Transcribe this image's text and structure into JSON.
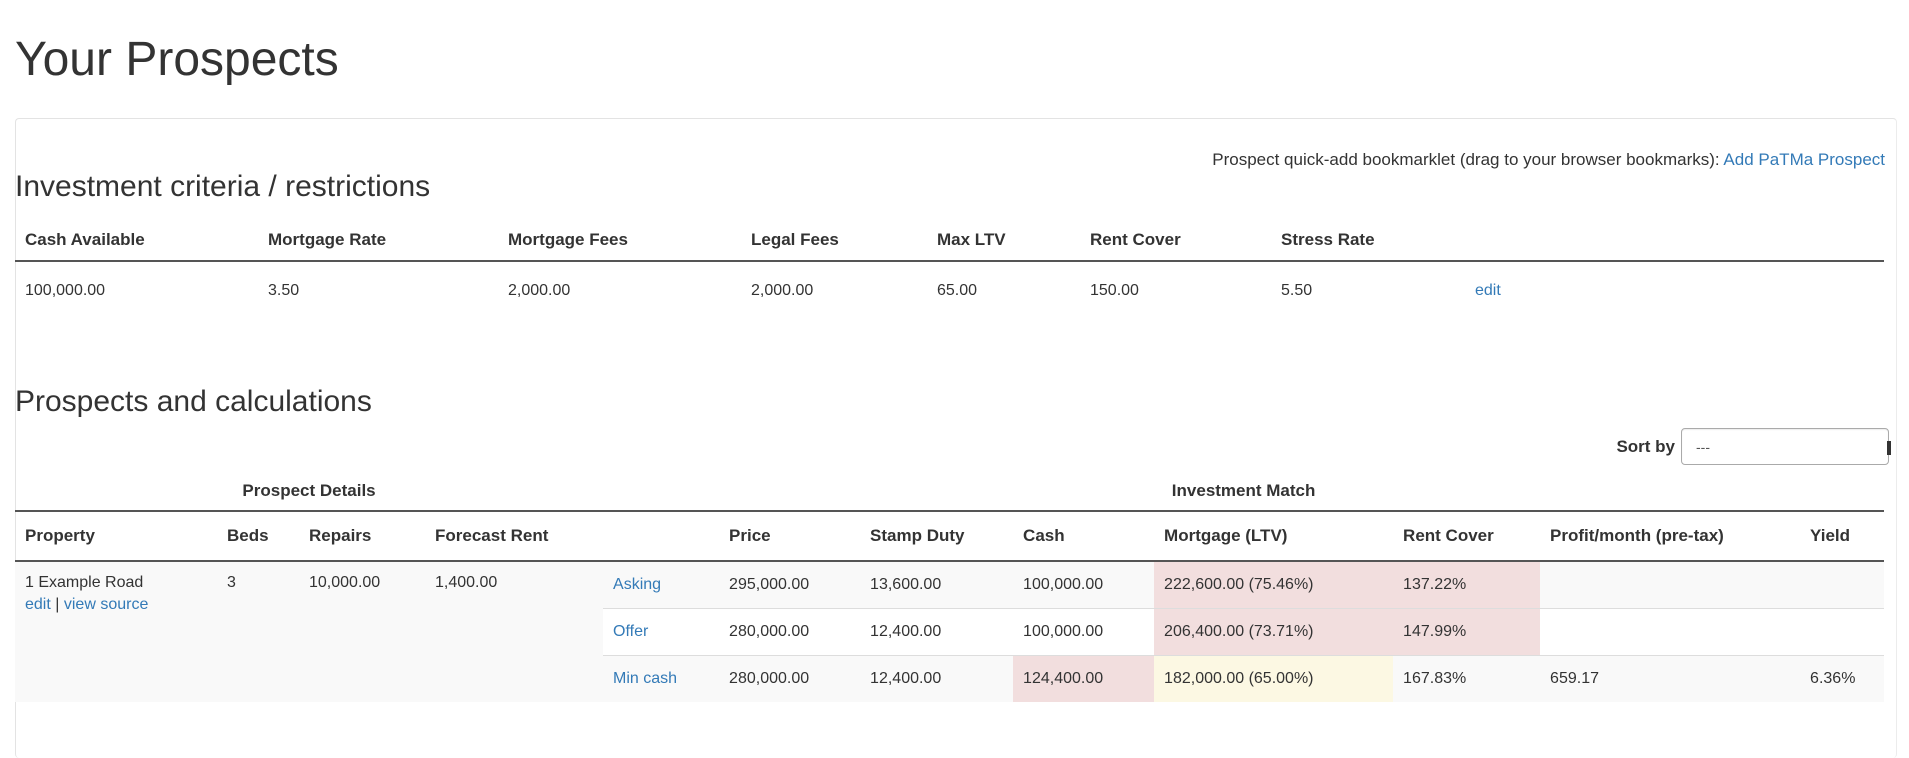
{
  "page_title": "Your Prospects",
  "bookmarklet": {
    "text": "Prospect quick-add bookmarklet (drag to your browser bookmarks): ",
    "link": "Add PaTMa Prospect"
  },
  "criteria": {
    "title": "Investment criteria / restrictions",
    "headers": [
      "Cash Available",
      "Mortgage Rate",
      "Mortgage Fees",
      "Legal Fees",
      "Max LTV",
      "Rent Cover",
      "Stress Rate"
    ],
    "values": [
      "100,000.00",
      "3.50",
      "2,000.00",
      "2,000.00",
      "65.00",
      "150.00",
      "5.50"
    ],
    "edit_label": "edit"
  },
  "prospects": {
    "title": "Prospects and calculations",
    "sort_label": "Sort by",
    "sort_value": "---",
    "group_headers": {
      "details": "Prospect Details",
      "match": "Investment Match"
    },
    "headers": [
      "Property",
      "Beds",
      "Repairs",
      "Forecast Rent",
      "",
      "Price",
      "Stamp Duty",
      "Cash",
      "Mortgage (LTV)",
      "Rent Cover",
      "Profit/month (pre-tax)",
      "Yield"
    ],
    "property": {
      "name": "1 Example Road",
      "edit_label": "edit",
      "separator": "|",
      "view_source_label": "view source",
      "beds": "3",
      "repairs": "10,000.00",
      "forecast_rent": "1,400.00"
    },
    "scenarios": [
      {
        "label": "Asking",
        "price": "295,000.00",
        "stamp_duty": "13,600.00",
        "cash": "100,000.00",
        "mortgage": "222,600.00 (75.46%)",
        "rent_cover": "137.22%",
        "profit": "",
        "yield": ""
      },
      {
        "label": "Offer",
        "price": "280,000.00",
        "stamp_duty": "12,400.00",
        "cash": "100,000.00",
        "mortgage": "206,400.00 (73.71%)",
        "rent_cover": "147.99%",
        "profit": "",
        "yield": ""
      },
      {
        "label": "Min cash",
        "price": "280,000.00",
        "stamp_duty": "12,400.00",
        "cash": "124,400.00",
        "mortgage": "182,000.00 (65.00%)",
        "rent_cover": "167.83%",
        "profit": "659.17",
        "yield": "6.36%"
      }
    ],
    "colors": {
      "danger": "#f2dede",
      "warning": "#fcf8e3",
      "link": "#337ab7"
    }
  }
}
